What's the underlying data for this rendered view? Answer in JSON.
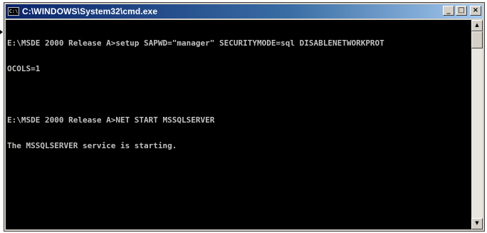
{
  "window": {
    "title": "C:\\WINDOWS\\System32\\cmd.exe",
    "icon": "cmd-icon",
    "icon_text": "C:\\",
    "buttons": {
      "minimize": "_",
      "maximize": "□",
      "close": "×"
    }
  },
  "console": {
    "lines": [
      "E:\\MSDE 2000 Release A>setup SAPWD=\"manager\" SECURITYMODE=sql DISABLENETWORKPROT",
      "OCOLS=1",
      "",
      "E:\\MSDE 2000 Release A>NET START MSSQLSERVER",
      "The MSSQLSERVER service is starting."
    ]
  },
  "scrollbar": {
    "up": "▲",
    "down": "▼"
  },
  "colors": {
    "titlebar_start": "#0a246a",
    "titlebar_end": "#a6caf0",
    "console_bg": "#000000",
    "console_fg": "#c0c0c0"
  }
}
